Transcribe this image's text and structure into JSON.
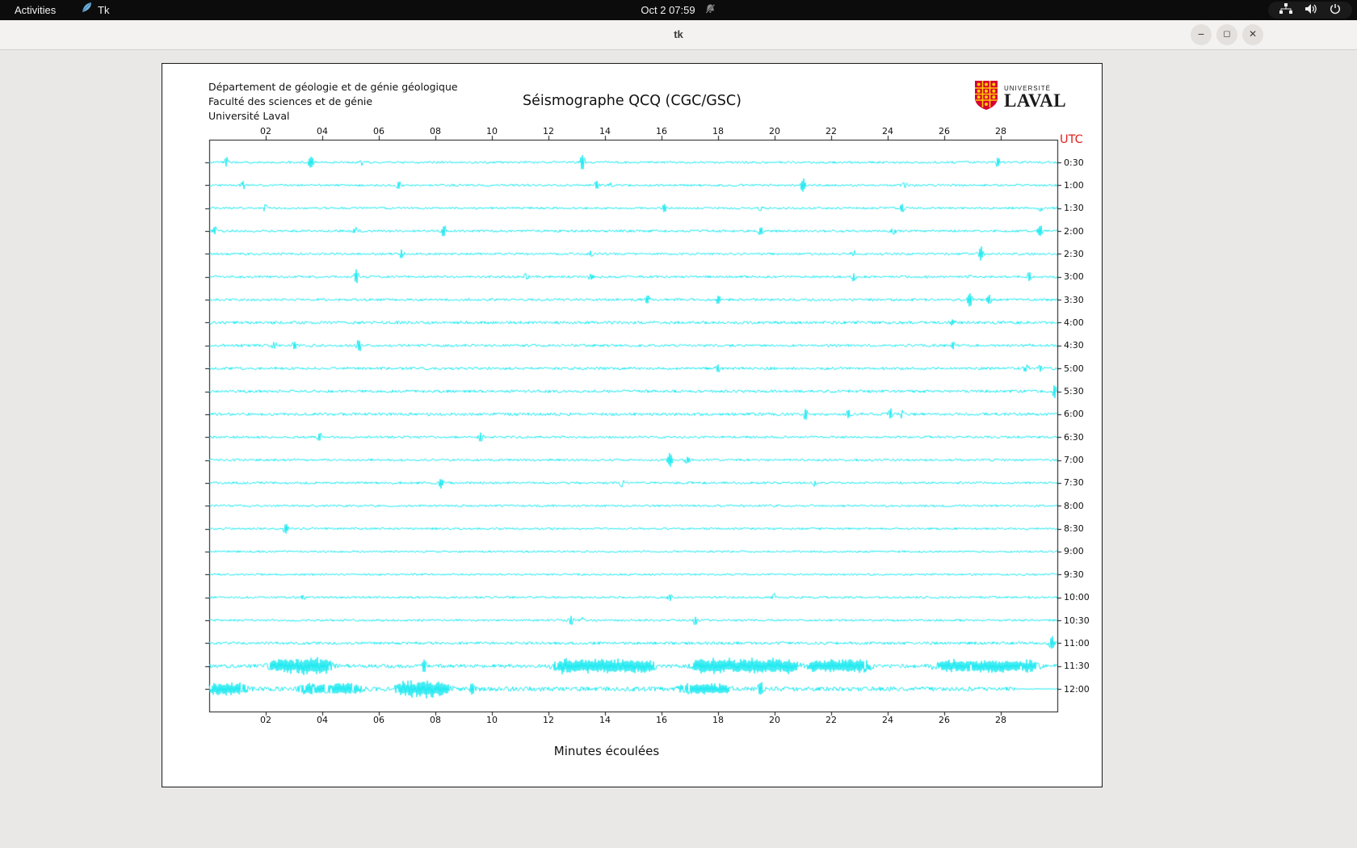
{
  "topbar": {
    "activities_label": "Activities",
    "app_name": "Tk",
    "clock": "Oct 2  07:59"
  },
  "titlebar": {
    "title": "tk",
    "minimize_glyph": "−",
    "maximize_glyph": "◻",
    "close_glyph": "✕"
  },
  "panel": {
    "header_line1": "Département de géologie et de génie géologique",
    "header_line2": "Faculté des sciences et de génie",
    "header_line3": "Université Laval",
    "title": "Séismographe QCQ (CGC/GSC)",
    "utc_label": "UTC",
    "xlabel": "Minutes écoulées",
    "logo_top": "UNIVERSITÉ",
    "logo_bottom": "LAVAL"
  },
  "chart_data": {
    "type": "line",
    "subtype": "seismograph-helicorder",
    "station": "QCQ (CGC/GSC)",
    "title": "Séismographe QCQ (CGC/GSC)",
    "xlabel": "Minutes écoulées",
    "x_minutes_range": [
      0,
      30
    ],
    "x_ticks": [
      "02",
      "04",
      "06",
      "08",
      "10",
      "12",
      "14",
      "16",
      "18",
      "20",
      "22",
      "24",
      "26",
      "28"
    ],
    "time_axis_label": "UTC",
    "trace_color": "#00e6ee",
    "rows": [
      {
        "label": "0:30",
        "amp": 1.3,
        "spikes": [
          {
            "m": 0.6,
            "a": 6
          },
          {
            "m": 3.6,
            "a": 9
          },
          {
            "m": 5.4,
            "a": 4
          },
          {
            "m": 13.2,
            "a": 11
          },
          {
            "m": 27.9,
            "a": 6
          }
        ]
      },
      {
        "label": "1:00",
        "amp": 1.3,
        "spikes": [
          {
            "m": 1.2,
            "a": 4
          },
          {
            "m": 6.7,
            "a": 5
          },
          {
            "m": 13.7,
            "a": 5
          },
          {
            "m": 14.2,
            "a": 3
          },
          {
            "m": 21.0,
            "a": 8
          },
          {
            "m": 24.6,
            "a": 3
          }
        ]
      },
      {
        "label": "1:30",
        "amp": 1.3,
        "spikes": [
          {
            "m": 2.0,
            "a": 4
          },
          {
            "m": 16.1,
            "a": 5
          },
          {
            "m": 19.5,
            "a": 3
          },
          {
            "m": 24.5,
            "a": 5
          },
          {
            "m": 29.4,
            "a": 4
          }
        ]
      },
      {
        "label": "2:00",
        "amp": 1.4,
        "spikes": [
          {
            "m": 0.2,
            "a": 5
          },
          {
            "m": 5.2,
            "a": 4
          },
          {
            "m": 8.3,
            "a": 7
          },
          {
            "m": 19.5,
            "a": 5
          },
          {
            "m": 24.2,
            "a": 4
          },
          {
            "m": 29.4,
            "a": 7
          }
        ]
      },
      {
        "label": "2:30",
        "amp": 1.4,
        "spikes": [
          {
            "m": 6.8,
            "a": 5
          },
          {
            "m": 13.5,
            "a": 4
          },
          {
            "m": 22.8,
            "a": 3
          },
          {
            "m": 27.3,
            "a": 8
          }
        ]
      },
      {
        "label": "3:00",
        "amp": 1.4,
        "spikes": [
          {
            "m": 5.2,
            "a": 8
          },
          {
            "m": 11.2,
            "a": 4
          },
          {
            "m": 13.5,
            "a": 4
          },
          {
            "m": 22.8,
            "a": 5
          },
          {
            "m": 26.9,
            "a": 3
          },
          {
            "m": 29.0,
            "a": 5
          }
        ]
      },
      {
        "label": "3:30",
        "amp": 1.5,
        "spikes": [
          {
            "m": 15.5,
            "a": 5
          },
          {
            "m": 18.0,
            "a": 5
          },
          {
            "m": 26.9,
            "a": 8
          },
          {
            "m": 27.6,
            "a": 5
          }
        ]
      },
      {
        "label": "4:00",
        "amp": 1.8,
        "spikes": [
          {
            "m": 26.3,
            "a": 3
          }
        ]
      },
      {
        "label": "4:30",
        "amp": 1.6,
        "spikes": [
          {
            "m": 2.3,
            "a": 4
          },
          {
            "m": 3.0,
            "a": 4
          },
          {
            "m": 5.3,
            "a": 7
          },
          {
            "m": 26.3,
            "a": 4
          },
          {
            "m": 29.0,
            "a": 3
          }
        ]
      },
      {
        "label": "5:00",
        "amp": 1.6,
        "spikes": [
          {
            "m": 18.0,
            "a": 5
          },
          {
            "m": 28.9,
            "a": 4
          },
          {
            "m": 29.4,
            "a": 4
          }
        ]
      },
      {
        "label": "5:30",
        "amp": 1.7,
        "spikes": [
          {
            "m": 29.9,
            "a": 7
          }
        ]
      },
      {
        "label": "6:00",
        "amp": 1.7,
        "spikes": [
          {
            "m": 21.1,
            "a": 6
          },
          {
            "m": 22.6,
            "a": 5
          },
          {
            "m": 24.1,
            "a": 6
          },
          {
            "m": 24.5,
            "a": 4
          }
        ]
      },
      {
        "label": "6:30",
        "amp": 1.4,
        "spikes": [
          {
            "m": 3.9,
            "a": 5
          },
          {
            "m": 9.6,
            "a": 5
          }
        ]
      },
      {
        "label": "7:00",
        "amp": 1.4,
        "spikes": [
          {
            "m": 16.3,
            "a": 8
          },
          {
            "m": 16.9,
            "a": 4
          }
        ]
      },
      {
        "label": "7:30",
        "amp": 1.4,
        "spikes": [
          {
            "m": 8.2,
            "a": 6
          },
          {
            "m": 14.6,
            "a": 4
          },
          {
            "m": 21.4,
            "a": 4
          }
        ]
      },
      {
        "label": "8:00",
        "amp": 1.3,
        "spikes": []
      },
      {
        "label": "8:30",
        "amp": 1.3,
        "spikes": [
          {
            "m": 2.7,
            "a": 6
          }
        ]
      },
      {
        "label": "9:00",
        "amp": 1.2,
        "spikes": []
      },
      {
        "label": "9:30",
        "amp": 1.2,
        "spikes": []
      },
      {
        "label": "10:00",
        "amp": 1.3,
        "spikes": [
          {
            "m": 3.3,
            "a": 3
          },
          {
            "m": 16.3,
            "a": 4
          },
          {
            "m": 20.0,
            "a": 4
          }
        ]
      },
      {
        "label": "10:30",
        "amp": 1.3,
        "spikes": [
          {
            "m": 12.8,
            "a": 5
          },
          {
            "m": 13.2,
            "a": 4
          },
          {
            "m": 17.2,
            "a": 5
          }
        ]
      },
      {
        "label": "11:00",
        "amp": 1.7,
        "spikes": [
          {
            "m": 29.8,
            "a": 9
          }
        ]
      },
      {
        "label": "11:30",
        "amp": 2.3,
        "spikes": [
          {
            "m": 7.6,
            "a": 6
          }
        ],
        "bursts": [
          {
            "m0": 2.3,
            "m1": 4.2,
            "a": 9
          },
          {
            "m0": 12.3,
            "m1": 15.6,
            "a": 8
          },
          {
            "m0": 17.3,
            "m1": 20.6,
            "a": 9
          },
          {
            "m0": 21.3,
            "m1": 23.2,
            "a": 8
          },
          {
            "m0": 25.8,
            "m1": 29.2,
            "a": 7
          }
        ]
      },
      {
        "label": "12:00",
        "amp": 2.8,
        "spikes": [
          {
            "m": 9.3,
            "a": 6
          },
          {
            "m": 19.5,
            "a": 9
          }
        ],
        "bursts": [
          {
            "m0": 0.0,
            "m1": 1.2,
            "a": 6
          },
          {
            "m0": 3.3,
            "m1": 5.3,
            "a": 5
          },
          {
            "m0": 6.8,
            "m1": 8.3,
            "a": 9
          },
          {
            "m0": 16.8,
            "m1": 18.3,
            "a": 5
          }
        ],
        "end_m": 28.5
      }
    ]
  }
}
